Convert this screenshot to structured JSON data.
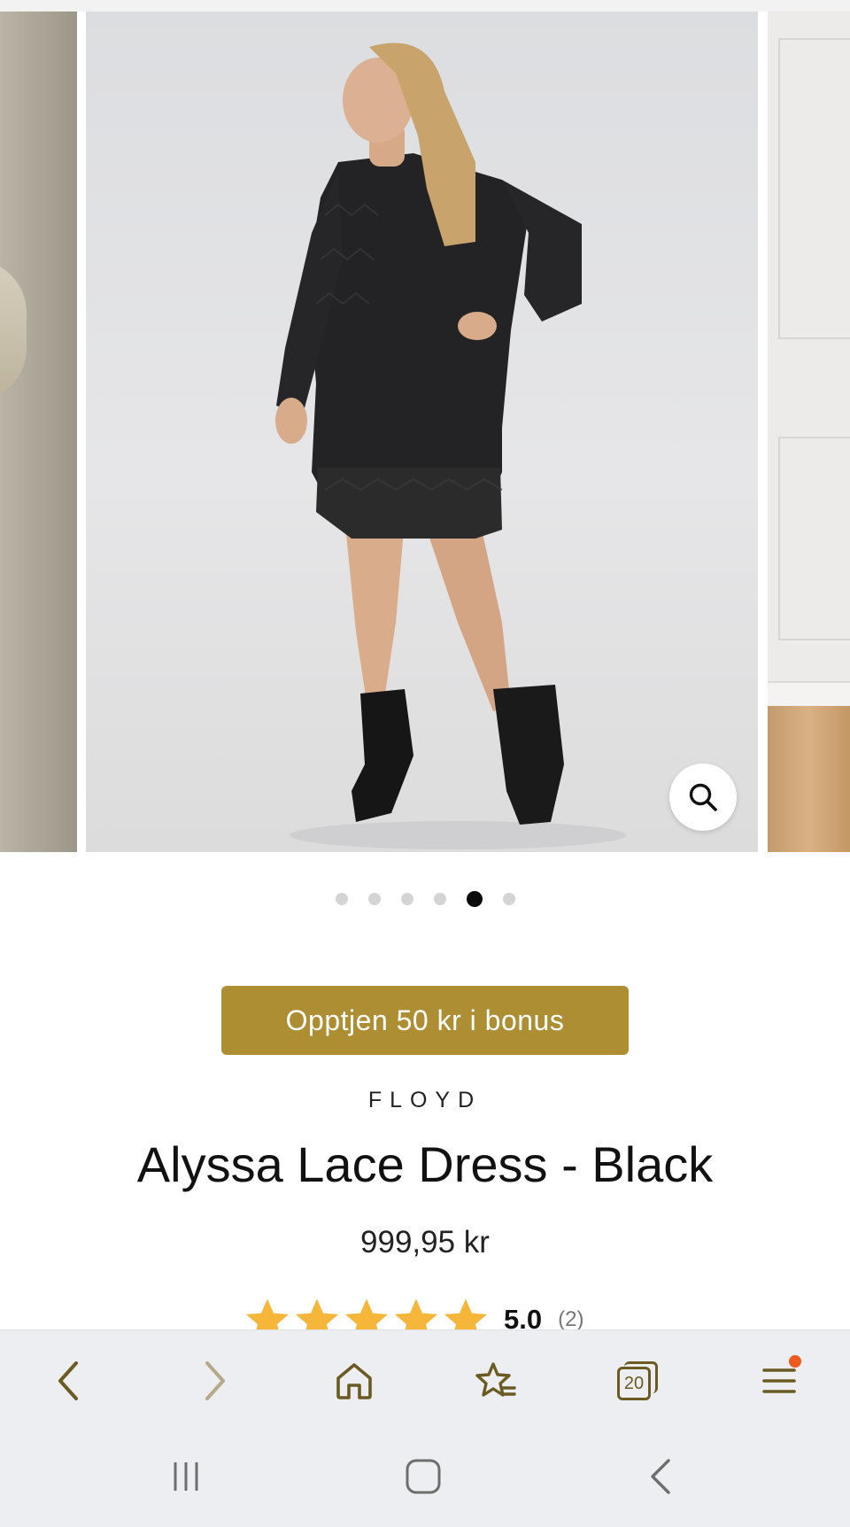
{
  "carousel": {
    "total_images": 6,
    "active_index": 4,
    "zoom_icon": "search-icon"
  },
  "promo": {
    "bonus_label": "Opptjen 50 kr i bonus"
  },
  "product": {
    "brand": "FLOYD",
    "title": "Alyssa Lace Dress - Black",
    "price": "999,95 kr",
    "rating": {
      "stars": 5,
      "max_stars": 5,
      "score": "5.0",
      "count": "(2)"
    }
  },
  "browser_toolbar": {
    "items": [
      "back-icon",
      "forward-icon",
      "home-icon",
      "bookmarks-icon",
      "tabs-icon",
      "menu-icon"
    ],
    "tab_count": "20",
    "menu_badge_color": "#ef5a1e"
  },
  "system_nav": {
    "items": [
      "recent-apps-icon",
      "home-icon",
      "back-icon"
    ]
  },
  "colors": {
    "accent": "#ad8e33",
    "star": "#f6b63a",
    "toolbar_icon": "#6b5a22"
  }
}
